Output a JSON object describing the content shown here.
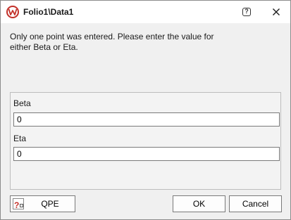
{
  "window": {
    "title": "Folio1\\Data1",
    "help_symbol": "?"
  },
  "message": {
    "line1": "Only one point was entered. Please enter the value for",
    "line2": "either Beta or Eta."
  },
  "fields": {
    "beta": {
      "label": "Beta",
      "value": "0"
    },
    "eta": {
      "label": "Eta",
      "value": "0"
    }
  },
  "buttons": {
    "qpe_label": "QPE",
    "qpe_icon_glyph": "?",
    "ok_label": "OK",
    "cancel_label": "Cancel"
  },
  "colors": {
    "brand_red": "#c3312a",
    "dialog_bg": "#f0f0f0"
  }
}
